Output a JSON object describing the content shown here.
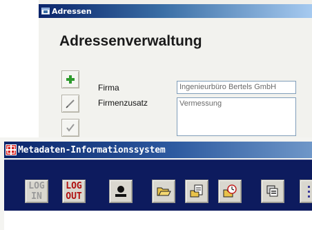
{
  "adressen_window": {
    "title": "Adressen",
    "heading": "Adressenverwaltung",
    "tool_buttons": [
      {
        "icon": "plus-icon",
        "color": "#2e8b2e"
      },
      {
        "icon": "pencil-icon"
      },
      {
        "icon": "checkmark-icon"
      }
    ],
    "form": {
      "firma_label": "Firma",
      "firma_value": "Ingenieurbüro Bertels GmbH",
      "zusatz_label": "Firmenzusatz",
      "zusatz_value": "Vermessung"
    }
  },
  "meta_window": {
    "title": "Metadaten-Informationssystem",
    "toolbar": {
      "login_line1": "LOG",
      "login_line2": "IN",
      "logout_line1": "LOG",
      "logout_line2": "OUT",
      "icons": [
        "user-icon",
        "folder-open-icon",
        "document-icon",
        "sync-icon",
        "copy-icon",
        "more-icon"
      ]
    },
    "colors": {
      "toolbar_bg": "#0d1b5e",
      "logout_text": "#b01010",
      "login_text": "#9a9a9a"
    }
  }
}
